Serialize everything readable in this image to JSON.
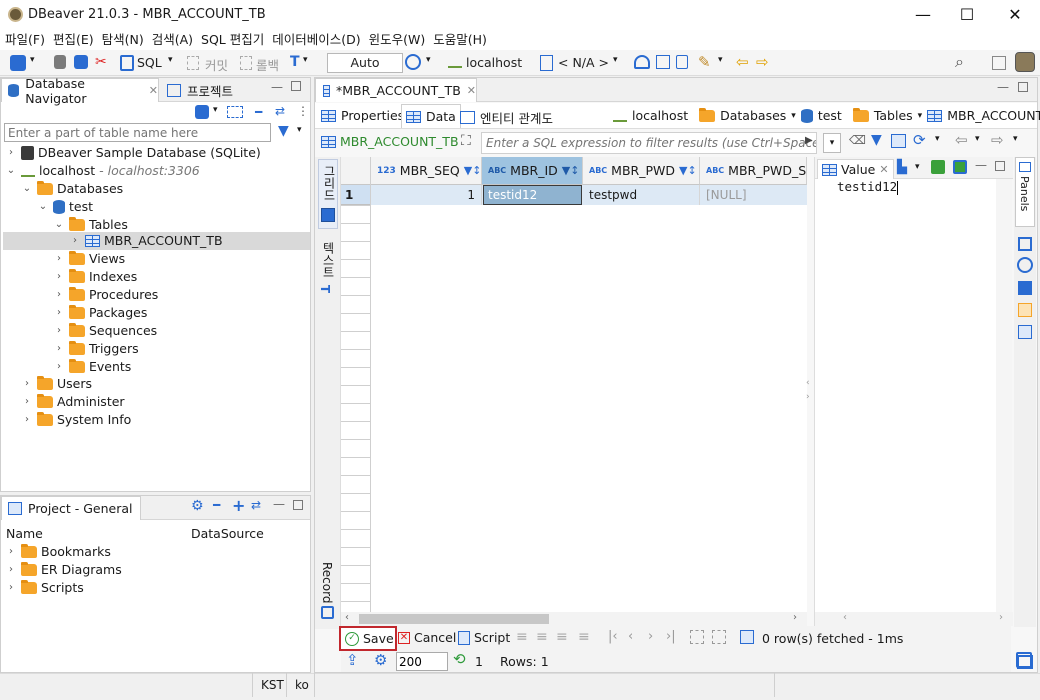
{
  "window": {
    "title": "DBeaver 21.0.3 - MBR_ACCOUNT_TB",
    "minimize": "—",
    "maximize": "☐",
    "close": "✕"
  },
  "menu": [
    "파일(F)",
    "편집(E)",
    "탐색(N)",
    "검색(A)",
    "SQL 편집기",
    "데이터베이스(D)",
    "윈도우(W)",
    "도움말(H)"
  ],
  "toolbar": {
    "sql": "SQL",
    "commit": "커밋",
    "rollback": "롤백",
    "transaction_mode": "Auto",
    "connection": "localhost",
    "schema": "< N/A >"
  },
  "navigator": {
    "tab_label": "Database Navigator",
    "project_tab_label": "프로젝트",
    "filter_placeholder": "Enter a part of table name here",
    "items": [
      {
        "label": "DBeaver Sample Database (SQLite)"
      },
      {
        "label": "localhost",
        "suffix": "- localhost:3306"
      },
      {
        "label": "Databases"
      },
      {
        "label": "test"
      },
      {
        "label": "Tables"
      },
      {
        "label": "MBR_ACCOUNT_TB"
      },
      {
        "label": "Views"
      },
      {
        "label": "Indexes"
      },
      {
        "label": "Procedures"
      },
      {
        "label": "Packages"
      },
      {
        "label": "Sequences"
      },
      {
        "label": "Triggers"
      },
      {
        "label": "Events"
      },
      {
        "label": "Users"
      },
      {
        "label": "Administer"
      },
      {
        "label": "System Info"
      }
    ]
  },
  "project": {
    "tab_label": "Project - General",
    "columns": [
      "Name",
      "DataSource"
    ],
    "items": [
      "Bookmarks",
      "ER Diagrams",
      "Scripts"
    ]
  },
  "editor": {
    "tab_label": "*MBR_ACCOUNT_TB",
    "subtabs": [
      "Properties",
      "Data",
      "엔티티 관계도"
    ],
    "breadcrumb": [
      "localhost",
      "Databases",
      "test",
      "Tables",
      "MBR_ACCOUNT_TB"
    ],
    "table_label": "MBR_ACCOUNT_TB",
    "filter_placeholder": "Enter a SQL expression to filter results (use Ctrl+Space)",
    "left_tabs": {
      "grid": "그리드",
      "text": "텍스트",
      "record": "Record"
    },
    "columns": [
      {
        "name": "MBR_SEQ",
        "type": "123"
      },
      {
        "name": "MBR_ID",
        "type": "ABC"
      },
      {
        "name": "MBR_PWD",
        "type": "ABC"
      },
      {
        "name": "MBR_PWD_SA",
        "type": "ABC"
      }
    ],
    "rows": [
      {
        "num": "1",
        "MBR_SEQ": "1",
        "MBR_ID": "testid12",
        "MBR_PWD": "testpwd",
        "MBR_PWD_SA": "[NULL]"
      }
    ],
    "value_panel": {
      "title": "Value",
      "content": "testid12"
    },
    "panels_tab": "Panels",
    "bottom": {
      "save": "Save",
      "cancel": "Cancel",
      "script": "Script",
      "fetched": "0 row(s) fetched - 1ms",
      "fetch_size": "200",
      "refresh_count": "1",
      "rows": "Rows: 1"
    }
  },
  "statusbar": {
    "timezone": "KST",
    "locale": "ko"
  },
  "colors": {
    "accent": "#2a6bd1",
    "selected_cell": "#8fb3d0",
    "save_highlight": "#c1272d"
  }
}
